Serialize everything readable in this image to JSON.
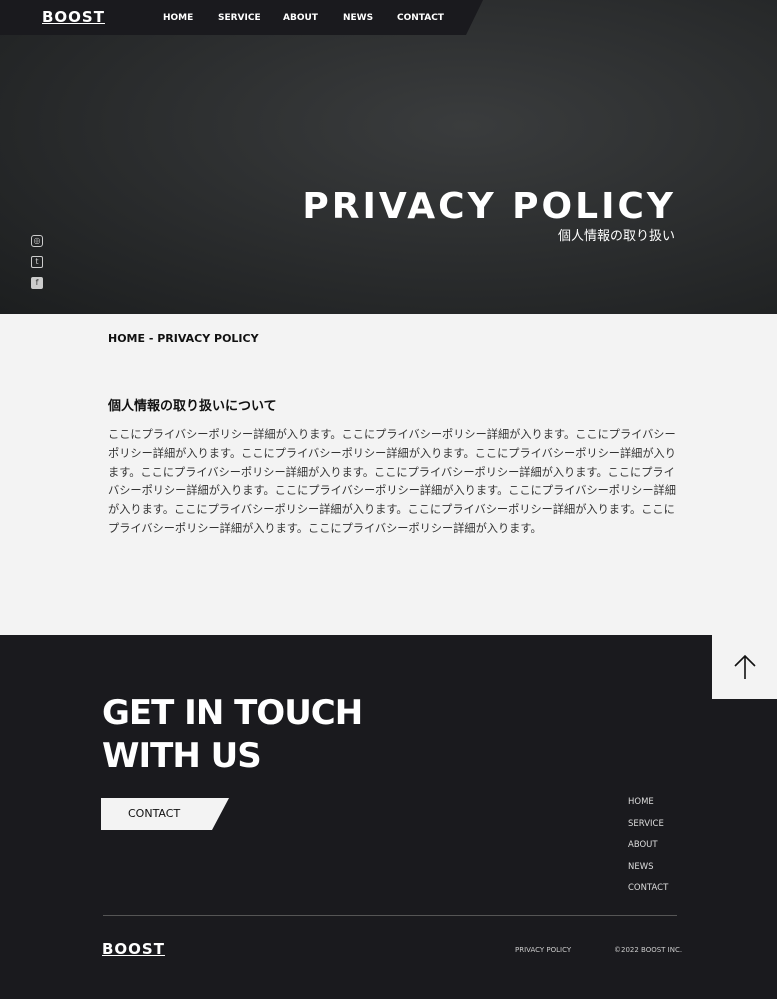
{
  "header": {
    "logo": "BOOST",
    "nav": [
      "HOME",
      "SERVICE",
      "ABOUT",
      "NEWS",
      "CONTACT"
    ]
  },
  "hero": {
    "title": "PRIVACY POLICY",
    "subtitle": "個人情報の取り扱い",
    "social": [
      "instagram-icon",
      "twitter-icon",
      "facebook-icon"
    ]
  },
  "breadcrumb": "HOME - PRIVACY POLICY",
  "content": {
    "heading": "個人情報の取り扱いについて",
    "body": "ここにプライバシーポリシー詳細が入ります。ここにプライバシーポリシー詳細が入ります。ここにプライバシーポリシー詳細が入ります。ここにプライバシーポリシー詳細が入ります。ここにプライバシーポリシー詳細が入ります。ここにプライバシーポリシー詳細が入ります。ここにプライバシーポリシー詳細が入ります。ここにプライバシーポリシー詳細が入ります。ここにプライバシーポリシー詳細が入ります。ここにプライバシーポリシー詳細が入ります。ここにプライバシーポリシー詳細が入ります。ここにプライバシーポリシー詳細が入ります。ここにプライバシーポリシー詳細が入ります。ここにプライバシーポリシー詳細が入ります。"
  },
  "footer": {
    "heading_1": "GET IN TOUCH",
    "heading_2": "WITH US",
    "contact_button": "CONTACT",
    "nav": [
      "HOME",
      "SERVICE",
      "ABOUT",
      "NEWS",
      "CONTACT"
    ],
    "logo": "BOOST",
    "privacy": "PRIVACY POLICY",
    "copyright": "©2022 BOOST INC."
  }
}
